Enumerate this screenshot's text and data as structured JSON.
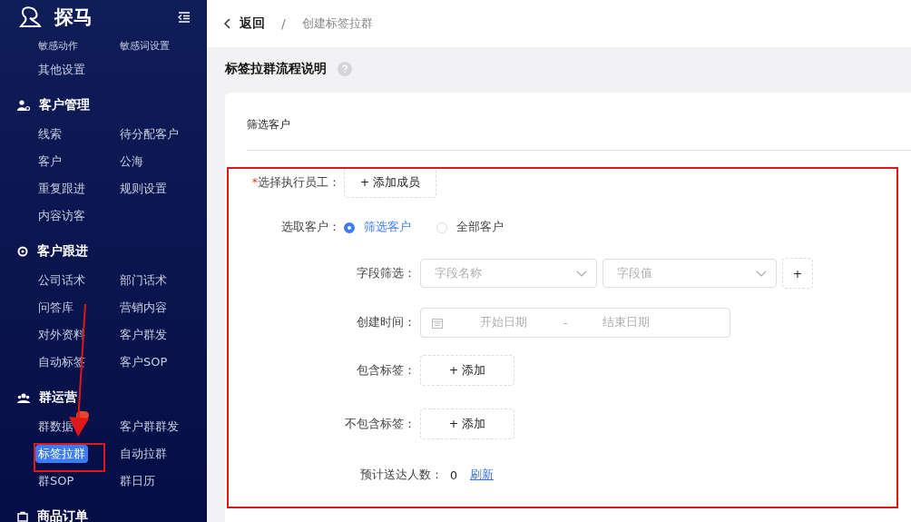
{
  "logo": {
    "name": "探马"
  },
  "sidebar": {
    "top_items": [
      {
        "label": "敏感动作",
        "selected": false
      },
      {
        "label": "敏感词设置",
        "selected": false
      },
      {
        "label": "其他设置",
        "selected": false
      }
    ],
    "sections": [
      {
        "title": "客户管理",
        "kind": "user",
        "items": [
          {
            "label": "线索",
            "selected": false
          },
          {
            "label": "待分配客户",
            "selected": false
          },
          {
            "label": "客户",
            "selected": false
          },
          {
            "label": "公海",
            "selected": false
          },
          {
            "label": "重复跟进",
            "selected": false
          },
          {
            "label": "规则设置",
            "selected": false
          },
          {
            "label": "内容访客",
            "selected": false
          }
        ]
      },
      {
        "title": "客户跟进",
        "kind": "target",
        "items": [
          {
            "label": "公司话术",
            "selected": false
          },
          {
            "label": "部门话术",
            "selected": false
          },
          {
            "label": "问答库",
            "selected": false
          },
          {
            "label": "营销内容",
            "selected": false
          },
          {
            "label": "对外资料",
            "selected": false
          },
          {
            "label": "客户群发",
            "selected": false
          },
          {
            "label": "自动标签",
            "selected": false
          },
          {
            "label": "客户SOP",
            "selected": false
          }
        ]
      },
      {
        "title": "群运营",
        "kind": "group",
        "items": [
          {
            "label": "群数据",
            "selected": false,
            "badge": true
          },
          {
            "label": "客户群群发",
            "selected": false
          },
          {
            "label": "标签拉群",
            "selected": true
          },
          {
            "label": "自动拉群",
            "selected": false
          },
          {
            "label": "群SOP",
            "selected": false
          },
          {
            "label": "群日历",
            "selected": false
          }
        ]
      },
      {
        "title": "商品订单",
        "kind": "bag"
      }
    ]
  },
  "breadcrumb": {
    "back": "返回",
    "separator": "/",
    "current": "创建标签拉群"
  },
  "page_title": "标签拉群流程说明",
  "card": {
    "step": "筛选客户",
    "employee": {
      "label": "选择执行员工：",
      "required_mark": "*",
      "button": "+ 添加成员"
    },
    "customer_select": {
      "label": "选取客户：",
      "options": [
        {
          "label": "筛选客户",
          "selected": true
        },
        {
          "label": "全部客户",
          "selected": false
        }
      ]
    },
    "field_filter": {
      "label": "字段筛选：",
      "name_placeholder": "字段名称",
      "value_placeholder": "字段值",
      "add_button": "+"
    },
    "created_time": {
      "label": "创建时间：",
      "start_placeholder": "开始日期",
      "separator": "-",
      "end_placeholder": "结束日期"
    },
    "include_tags": {
      "label": "包含标签：",
      "button": "+ 添加"
    },
    "exclude_tags": {
      "label": "不包含标签：",
      "button": "+ 添加"
    },
    "estimate": {
      "label": "预计送达人数：",
      "value": "0",
      "refresh": "刷新"
    }
  }
}
